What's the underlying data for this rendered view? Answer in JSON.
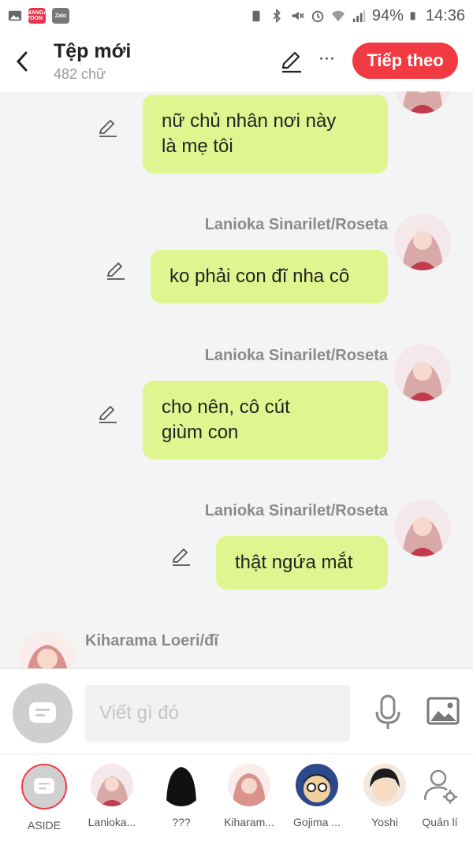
{
  "status_bar": {
    "apps": [
      "MANGA TOON",
      "Zalo"
    ],
    "battery": "94%",
    "time": "14:36"
  },
  "header": {
    "title": "Tệp mới",
    "subtitle": "482 chữ",
    "next_label": "Tiếp theo"
  },
  "messages": [
    {
      "name": "",
      "text_lines": [
        "nữ chủ nhân nơi này",
        "là mẹ tôi"
      ]
    },
    {
      "name": "Lanioka Sinarilet/Roseta",
      "text_lines": [
        "ko phải con đĩ nha cô"
      ]
    },
    {
      "name": "Lanioka Sinarilet/Roseta",
      "text_lines": [
        "cho nên, cô cút",
        "giùm con"
      ]
    },
    {
      "name": "Lanioka Sinarilet/Roseta",
      "text_lines": [
        "thật ngứa mắt"
      ]
    },
    {
      "name": "Kiharama Loeri/đĩ",
      "text_lines": []
    }
  ],
  "composer": {
    "placeholder": "Viết gì đó"
  },
  "characters": [
    {
      "label": "ASIDE",
      "icon": "aside-icon"
    },
    {
      "label": "Lanioka..."
    },
    {
      "label": "???"
    },
    {
      "label": "Kiharam..."
    },
    {
      "label": "Gojima ..."
    },
    {
      "label": "Yoshi"
    },
    {
      "label": "Quản lí",
      "icon": "manage-user-icon"
    }
  ],
  "colors": {
    "accent": "#f23a42",
    "bubble": "#dff58f"
  }
}
